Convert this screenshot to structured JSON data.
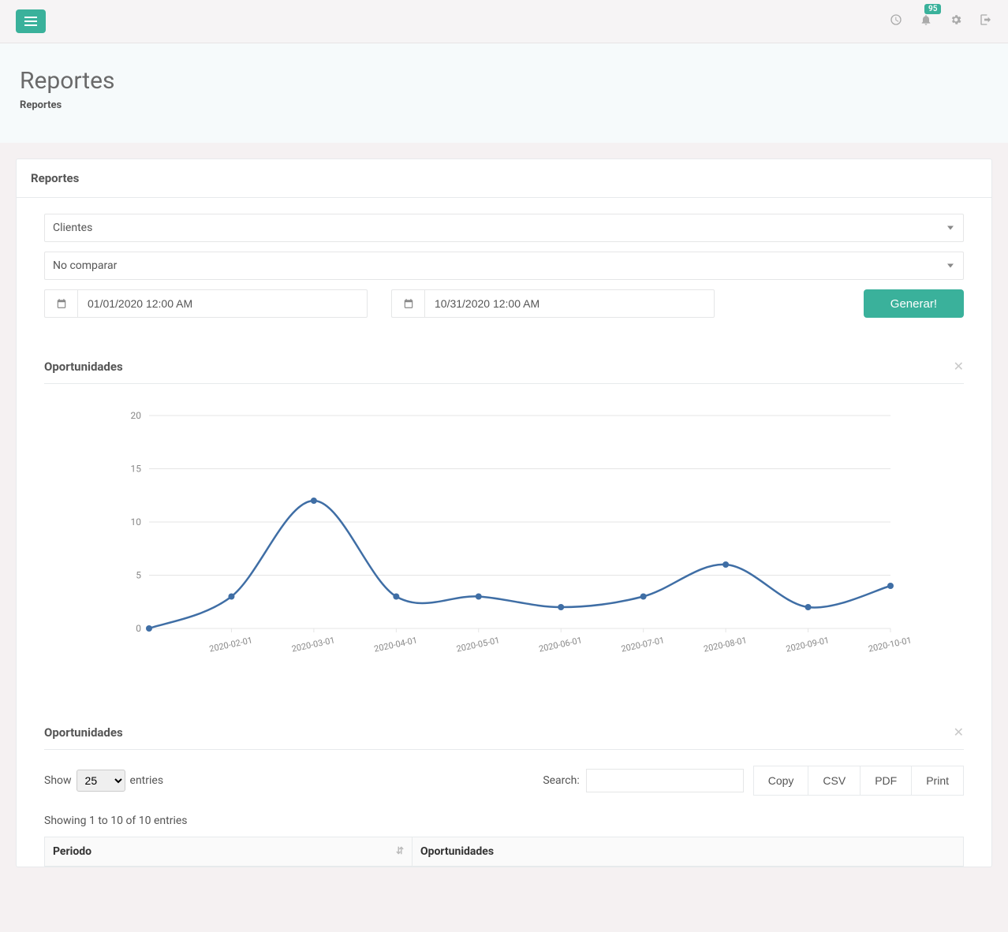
{
  "header": {
    "notifications_count": "95"
  },
  "page": {
    "title": "Reportes",
    "breadcrumb": "Reportes"
  },
  "panel": {
    "title": "Reportes",
    "select_report": "Clientes",
    "select_compare": "No comparar",
    "date_from": "01/01/2020 12:00 AM",
    "date_to": "10/31/2020 12:00 AM",
    "generate_label": "Generar!"
  },
  "chart_section": {
    "title": "Oportunidades"
  },
  "chart_data": {
    "type": "line",
    "title": "Oportunidades",
    "xlabel": "",
    "ylabel": "",
    "ylim": [
      0,
      20
    ],
    "yticks": [
      0,
      5,
      10,
      15,
      20
    ],
    "x": [
      "2020-01-01",
      "2020-02-01",
      "2020-03-01",
      "2020-04-01",
      "2020-05-01",
      "2020-06-01",
      "2020-07-01",
      "2020-08-01",
      "2020-09-01",
      "2020-10-01"
    ],
    "x_ticks": [
      "2020-02-01",
      "2020-03-01",
      "2020-04-01",
      "2020-05-01",
      "2020-06-01",
      "2020-07-01",
      "2020-08-01",
      "2020-09-01",
      "2020-10-01"
    ],
    "series": [
      {
        "name": "Oportunidades",
        "values": [
          0,
          3,
          12,
          3,
          3,
          2,
          3,
          6,
          2,
          4
        ]
      }
    ]
  },
  "table_section": {
    "title": "Oportunidades",
    "show_label_prefix": "Show",
    "show_label_suffix": "entries",
    "show_value": "25",
    "search_label": "Search:",
    "buttons": {
      "copy": "Copy",
      "csv": "CSV",
      "pdf": "PDF",
      "print": "Print"
    },
    "info": "Showing 1 to 10 of 10 entries",
    "columns": {
      "periodo": "Periodo",
      "oportunidades": "Oportunidades"
    }
  }
}
